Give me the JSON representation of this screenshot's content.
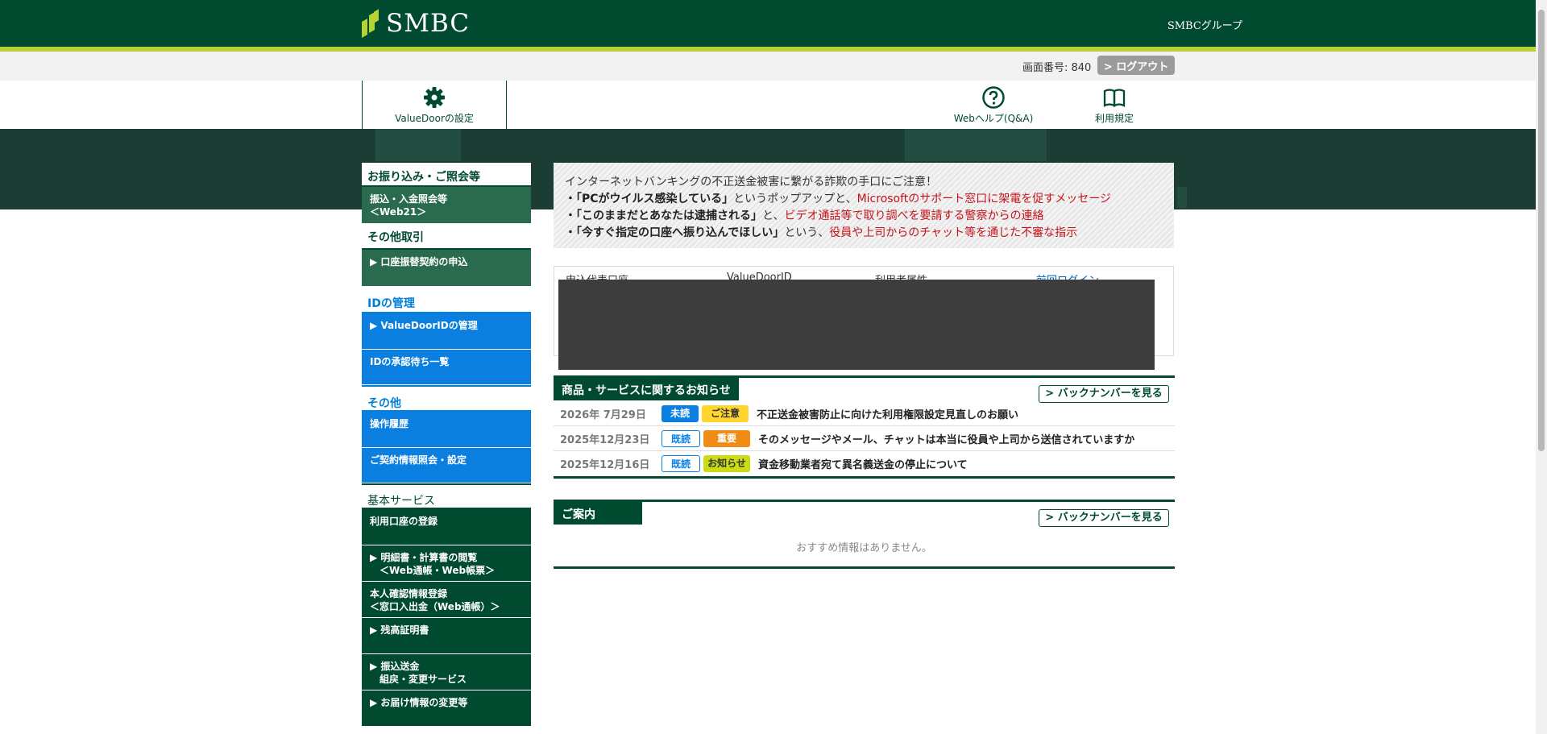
{
  "header": {
    "brand": "SMBC",
    "group_link": "SMBCグループ",
    "screen_no": "画面番号: 840",
    "logout": "> ログアウト"
  },
  "nav": {
    "settings": "ValueDoorの設定",
    "help": "Webヘルプ(Q&A)",
    "terms": "利用規定"
  },
  "sidebar": {
    "sections": [
      {
        "heading": "お振り込み・ご照会等",
        "style": "dark"
      },
      {
        "heading": "その他取引",
        "style": "dark"
      },
      {
        "heading": "IDの管理",
        "style": "blue"
      },
      {
        "heading": "その他",
        "style": "blue"
      },
      {
        "heading": "基本サービス",
        "style": "dark"
      }
    ],
    "items": {
      "transfer_inquiry_l1": "振込・入金照会等",
      "transfer_inquiry_l2": "＜Web21＞",
      "account_transfer": "▶ 口座振替契約の申込",
      "id_manage": "▶ ValueDoorIDの管理",
      "id_approval": "IDの承認待ち一覧",
      "history": "操作履歴",
      "contract": "ご契約情報照会・設定",
      "account_reg": "利用口座の登録",
      "statement_l1": "▶ 明細書・計算書の閲覧",
      "statement_l2": "　＜Web通帳・Web帳票＞",
      "identity_l1": "本人確認情報登録",
      "identity_l2": "＜窓口入出金（Web通帳）＞",
      "balance": "▶ 残高証明書",
      "remit_l1": "▶ 振込送金",
      "remit_l2": "　組戻・変更サービス",
      "notify_change": "▶ お届け情報の変更等"
    }
  },
  "warning": {
    "title": "インターネットバンキングの不正送金被害に繋がる詐欺の手口にご注意！",
    "line1_bold": "・「PCがウイルス感染している」",
    "line1_mid": "というポップアップと、",
    "line1_red": "Microsoftのサポート窓口に架電を促すメッセージ",
    "line2_bold": "・「このままだとあなたは逮捕される」",
    "line2_mid": "と、",
    "line2_red": "ビデオ通話等で取り調べを要請する警察からの連絡",
    "line3_bold": "・「今すぐ指定の口座へ振り込んでほしい」",
    "line3_mid": "という、",
    "line3_red": "役員や上司からのチャット等を通じた不審な指示"
  },
  "account": {
    "col1": "申込代表口座",
    "col2": "ValueDoorID",
    "col3": "利用者属性",
    "col4": "前回ログイン"
  },
  "news": {
    "title": "商品・サービスに関するお知らせ",
    "back": "> バックナンバーを見る",
    "rows": [
      {
        "date": "2026年 7月29日",
        "status": "未読",
        "tag": "ご注意",
        "text": "不正送金被害防止に向けた利用権限設定見直しのお願い"
      },
      {
        "date": "2025年12月23日",
        "status": "既読",
        "tag": "重要",
        "text": "そのメッセージやメール、チャットは本当に役員や上司から送信されていますか"
      },
      {
        "date": "2025年12月16日",
        "status": "既読",
        "tag": "お知らせ",
        "text": "資金移動業者宛て異名義送金の停止について"
      }
    ]
  },
  "guide": {
    "title": "ご案内",
    "back": "> バックナンバーを見る",
    "empty": "おすすめ情報はありません。"
  },
  "colors": {
    "brand_green": "#004a2f",
    "accent_lime": "#b5d334",
    "blue": "#0a7fe0",
    "alert_red": "#c4121a"
  }
}
